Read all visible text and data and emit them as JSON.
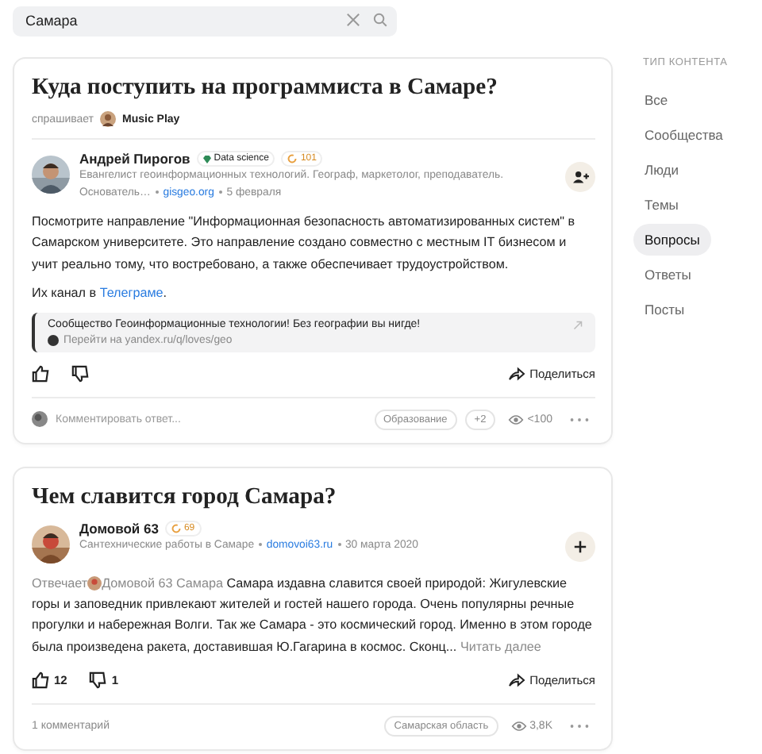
{
  "search": {
    "value": "Самара"
  },
  "cards": [
    {
      "title": "Куда поступить на программиста в Самаре?",
      "asker": {
        "label": "спрашивает",
        "name": "Music Play"
      },
      "author": {
        "name": "Андрей Пирогов",
        "topic": "Data science",
        "score": "101",
        "bio": "Евангелист геоинформационных технологий. Географ, маркетолог, преподаватель. Основатель…",
        "site": "gisgeo.org",
        "date": "5 февраля",
        "follow_button": {
          "kind": "person-add"
        }
      },
      "paragraphs": [
        {
          "text": "Посмотрите направление \"Информационная безопасность автоматизированных систем\" в Самарском университете. Это направление создано совместно с местным IT бизнесом и учит реально тому, что востребовано, а также обеспечивает трудоустройством."
        },
        {
          "text": "Их канал в ",
          "link": "Телеграме",
          "after": "."
        }
      ],
      "quote": {
        "text": "Сообщество Геоинформационные технологии! Без географии вы нигде!",
        "link": "Перейти на yandex.ru/q/loves/geo"
      },
      "share": "Поделиться",
      "footer": {
        "comment_placeholder": "Комментировать ответ...",
        "tags": [
          "Образование",
          "+2"
        ],
        "views": "<100"
      }
    },
    {
      "title": "Чем славится город Самара?",
      "author": {
        "name": "Домовой 63",
        "score": "69",
        "bio": "Сантехнические работы в Самаре",
        "site": "domovoi63.ru",
        "date": "30 марта 2020",
        "follow_button": {
          "kind": "plus"
        }
      },
      "answer_intro": {
        "label": "Отвечает",
        "name": "Домовой 63 Самара",
        "text": "Самара издавна славится своей природой: Жигулевские горы и заповедник привлекают жителей и гостей нашего города. Очень популярны речные прогулки и набережная Волги. Так же Самара - это космический город. Именно в этом городе была произведена ракета, доставившая Ю.Гагарина в космос. Сконц...",
        "more": "Читать далее"
      },
      "likes": "12",
      "dislikes": "1",
      "share": "Поделиться",
      "footer": {
        "comments": "1 комментарий",
        "tags": [
          "Самарская область"
        ],
        "views": "3,8K"
      }
    }
  ],
  "sidebar": {
    "title": "ТИП КОНТЕНТА",
    "items": [
      {
        "label": "Все",
        "selected": false
      },
      {
        "label": "Сообщества",
        "selected": false
      },
      {
        "label": "Люди",
        "selected": false
      },
      {
        "label": "Темы",
        "selected": false
      },
      {
        "label": "Вопросы",
        "selected": true
      },
      {
        "label": "Ответы",
        "selected": false
      },
      {
        "label": "Посты",
        "selected": false
      }
    ]
  }
}
